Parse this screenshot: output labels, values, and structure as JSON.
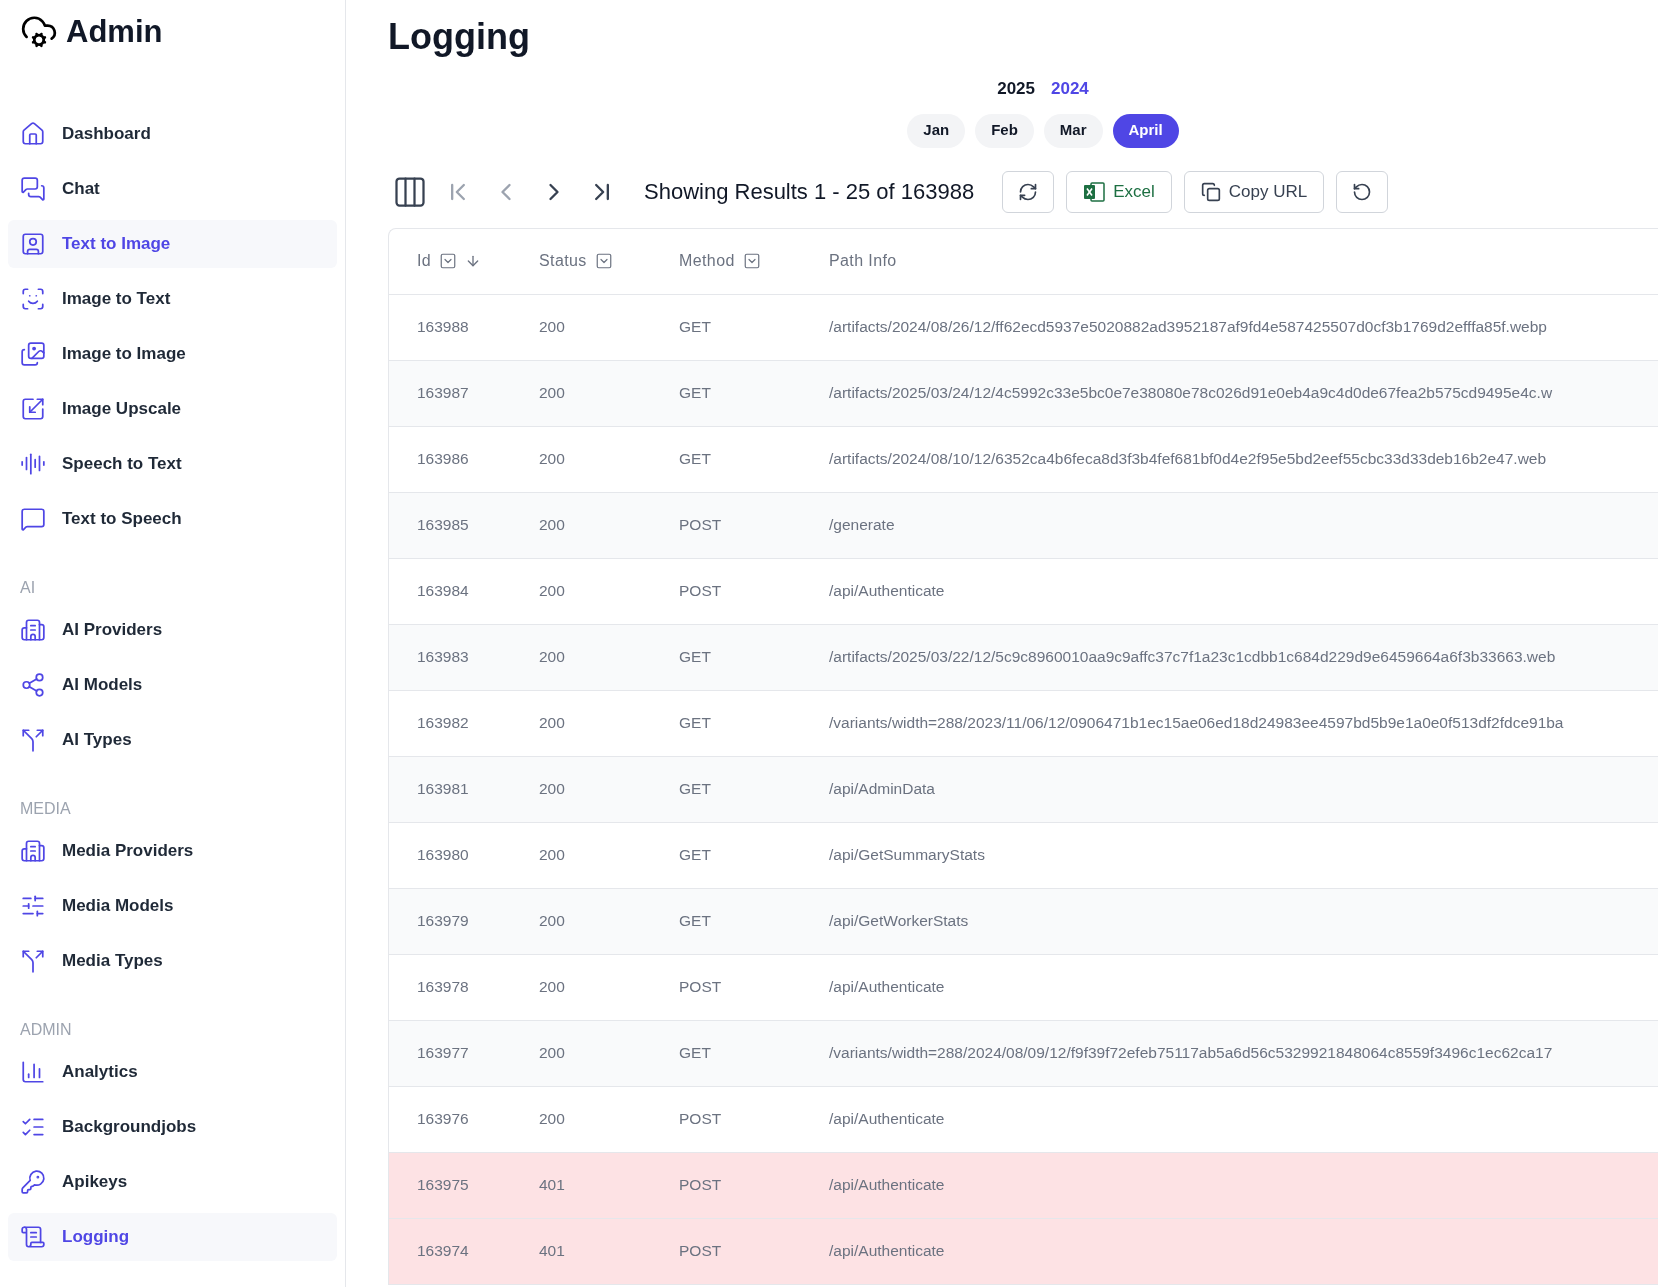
{
  "brand": {
    "title": "Admin"
  },
  "sidebar": {
    "sections": [
      {
        "items": [
          {
            "label": "Dashboard",
            "selected": false
          },
          {
            "label": "Chat",
            "selected": false
          },
          {
            "label": "Text to Image",
            "selected": true
          },
          {
            "label": "Image to Text",
            "selected": false
          },
          {
            "label": "Image to Image",
            "selected": false
          },
          {
            "label": "Image Upscale",
            "selected": false
          },
          {
            "label": "Speech to Text",
            "selected": false
          },
          {
            "label": "Text to Speech",
            "selected": false
          }
        ]
      },
      {
        "heading": "AI",
        "items": [
          {
            "label": "AI Providers",
            "selected": false
          },
          {
            "label": "AI Models",
            "selected": false
          },
          {
            "label": "AI Types",
            "selected": false
          }
        ]
      },
      {
        "heading": "MEDIA",
        "items": [
          {
            "label": "Media Providers",
            "selected": false
          },
          {
            "label": "Media Models",
            "selected": false
          },
          {
            "label": "Media Types",
            "selected": false
          }
        ]
      },
      {
        "heading": "ADMIN",
        "items": [
          {
            "label": "Analytics",
            "selected": false
          },
          {
            "label": "Backgroundjobs",
            "selected": false
          },
          {
            "label": "Apikeys",
            "selected": false
          },
          {
            "label": "Logging",
            "selected": true
          }
        ]
      }
    ]
  },
  "page": {
    "title": "Logging"
  },
  "years": [
    {
      "label": "2025",
      "selected": true
    },
    {
      "label": "2024",
      "selected": false
    }
  ],
  "months": [
    {
      "label": "Jan",
      "selected": false
    },
    {
      "label": "Feb",
      "selected": false
    },
    {
      "label": "Mar",
      "selected": false
    },
    {
      "label": "April",
      "selected": true
    }
  ],
  "toolbar": {
    "first_disabled": true,
    "prev_disabled": true,
    "next_disabled": false,
    "last_disabled": false,
    "results": "Showing Results 1 - 25 of 163988",
    "excel": "Excel",
    "copy_url": "Copy URL"
  },
  "table": {
    "columns": [
      {
        "label": "Id",
        "filter": true,
        "sorted": true
      },
      {
        "label": "Status",
        "filter": true,
        "sorted": false
      },
      {
        "label": "Method",
        "filter": true,
        "sorted": false
      },
      {
        "label": "Path Info",
        "filter": false,
        "sorted": false
      }
    ],
    "rows": [
      {
        "cells": [
          "163988",
          "200",
          "GET",
          "/artifacts/2024/08/26/12/ff62ecd5937e5020882ad3952187af9fd4e587425507d0cf3b1769d2efffa85f.webp"
        ],
        "error": false
      },
      {
        "cells": [
          "163987",
          "200",
          "GET",
          "/artifacts/2025/03/24/12/4c5992c33e5bc0e7e38080e78c026d91e0eb4a9c4d0de67fea2b575cd9495e4c.w"
        ],
        "error": false
      },
      {
        "cells": [
          "163986",
          "200",
          "GET",
          "/artifacts/2024/08/10/12/6352ca4b6feca8d3f3b4fef681bf0d4e2f95e5bd2eef55cbc33d33deb16b2e47.web"
        ],
        "error": false
      },
      {
        "cells": [
          "163985",
          "200",
          "POST",
          "/generate"
        ],
        "error": false
      },
      {
        "cells": [
          "163984",
          "200",
          "POST",
          "/api/Authenticate"
        ],
        "error": false
      },
      {
        "cells": [
          "163983",
          "200",
          "GET",
          "/artifacts/2025/03/22/12/5c9c8960010aa9c9affc37c7f1a23c1cdbb1c684d229d9e6459664a6f3b33663.web"
        ],
        "error": false
      },
      {
        "cells": [
          "163982",
          "200",
          "GET",
          "/variants/width=288/2023/11/06/12/0906471b1ec15ae06ed18d24983ee4597bd5b9e1a0e0f513df2fdce91ba"
        ],
        "error": false
      },
      {
        "cells": [
          "163981",
          "200",
          "GET",
          "/api/AdminData"
        ],
        "error": false
      },
      {
        "cells": [
          "163980",
          "200",
          "GET",
          "/api/GetSummaryStats"
        ],
        "error": false
      },
      {
        "cells": [
          "163979",
          "200",
          "GET",
          "/api/GetWorkerStats"
        ],
        "error": false
      },
      {
        "cells": [
          "163978",
          "200",
          "POST",
          "/api/Authenticate"
        ],
        "error": false
      },
      {
        "cells": [
          "163977",
          "200",
          "GET",
          "/variants/width=288/2024/08/09/12/f9f39f72efeb75117ab5a6d56c5329921848064c8559f3496c1ec62ca17"
        ],
        "error": false
      },
      {
        "cells": [
          "163976",
          "200",
          "POST",
          "/api/Authenticate"
        ],
        "error": false
      },
      {
        "cells": [
          "163975",
          "401",
          "POST",
          "/api/Authenticate"
        ],
        "error": true
      },
      {
        "cells": [
          "163974",
          "401",
          "POST",
          "/api/Authenticate"
        ],
        "error": true
      }
    ]
  }
}
